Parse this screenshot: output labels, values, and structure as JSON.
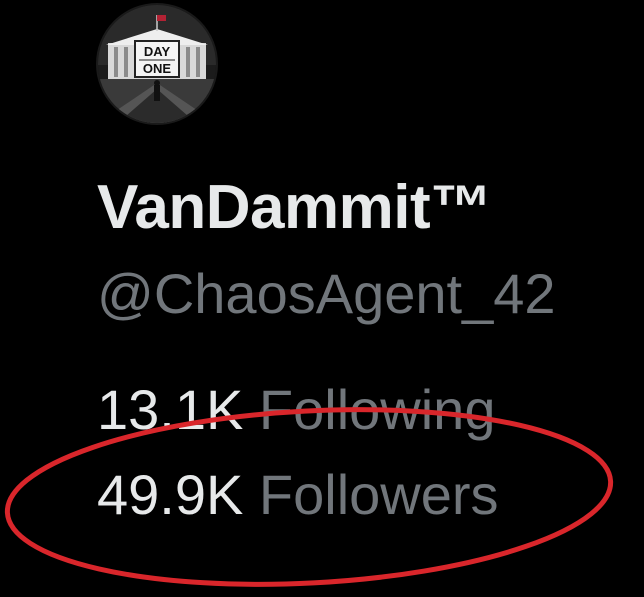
{
  "profile": {
    "avatar_text_top": "DAY",
    "avatar_text_bottom": "ONE",
    "display_name": "VanDammit™",
    "handle": "@ChaosAgent_42"
  },
  "stats": {
    "following_count": "13.1K",
    "following_label": "Following",
    "followers_count": "49.9K",
    "followers_label": "Followers"
  },
  "colors": {
    "background": "#000000",
    "primary_text": "#e7e9ea",
    "secondary_text": "#71767b",
    "annotation": "#d9262b"
  }
}
